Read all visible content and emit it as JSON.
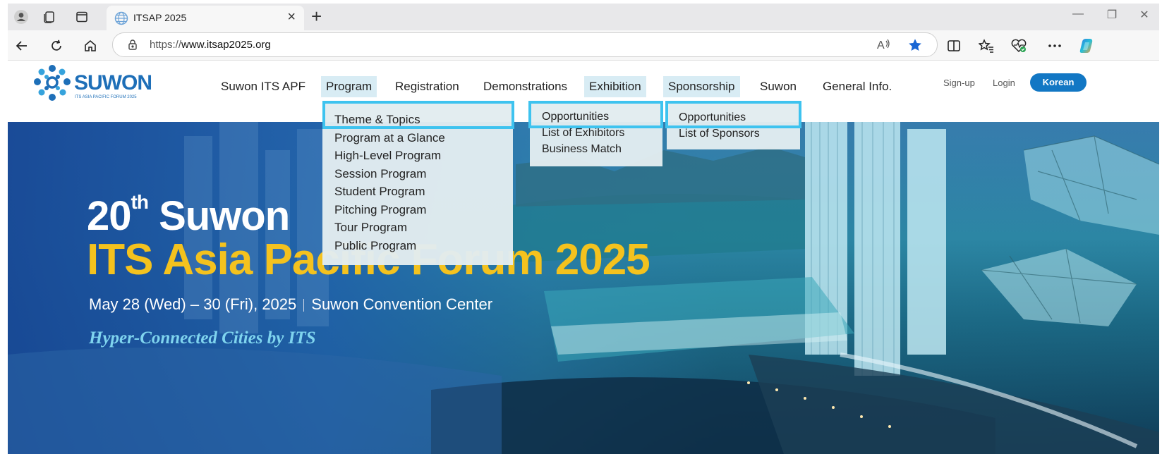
{
  "browser": {
    "tab_title": "ITSAP 2025",
    "tab_close": "×",
    "new_tab": "+",
    "url_prefix": "https://",
    "url_host": "www.itsap2025.org",
    "window_controls": [
      "—",
      "❐",
      "✕"
    ],
    "icons": [
      "profile-icon",
      "collections-icon",
      "tab-actions-icon",
      "favicon-icon",
      "back-icon",
      "refresh-icon",
      "home-icon",
      "lock-icon",
      "read-aloud-icon",
      "favorite-star-icon",
      "split-screen-icon",
      "favorites-list-icon",
      "browser-essentials-icon",
      "more-icon",
      "copilot-icon"
    ]
  },
  "site": {
    "logo_text": "SUWON",
    "logo_sub": "ITS ASIA PACIFIC FORUM 2025",
    "nav": [
      {
        "label": "Suwon ITS APF",
        "highlighted": false
      },
      {
        "label": "Program",
        "highlighted": true
      },
      {
        "label": "Registration",
        "highlighted": false
      },
      {
        "label": "Demonstrations",
        "highlighted": false
      },
      {
        "label": "Exhibition",
        "highlighted": true
      },
      {
        "label": "Sponsorship",
        "highlighted": true
      },
      {
        "label": "Suwon",
        "highlighted": false
      },
      {
        "label": "General Info.",
        "highlighted": false
      }
    ],
    "utility": {
      "signup": "Sign-up",
      "login": "Login",
      "korean": "Korean"
    },
    "accent_color": "#1277c4",
    "highlight_color": "#3ec3ef"
  },
  "dropdowns": {
    "program": [
      "Theme & Topics",
      "Program at a Glance",
      "High-Level Program",
      "Session Program",
      "Student Program",
      "Pitching Program",
      "Tour Program",
      "Public Program"
    ],
    "exhibition": [
      "Opportunities",
      "List of Exhibitors",
      "Business Match"
    ],
    "sponsorship": [
      "Opportunities",
      "List of Sponsors"
    ]
  },
  "hero": {
    "line1_num": "20",
    "line1_sup": "th",
    "line1_text": " Suwon",
    "line2": "ITS Asia Pacific Forum 2025",
    "dates": "May 28 (Wed) – 30 (Fri), 2025",
    "venue": "Suwon Convention Center",
    "tagline": "Hyper-Connected Cities by ITS",
    "title_color": "#f4c21e"
  }
}
